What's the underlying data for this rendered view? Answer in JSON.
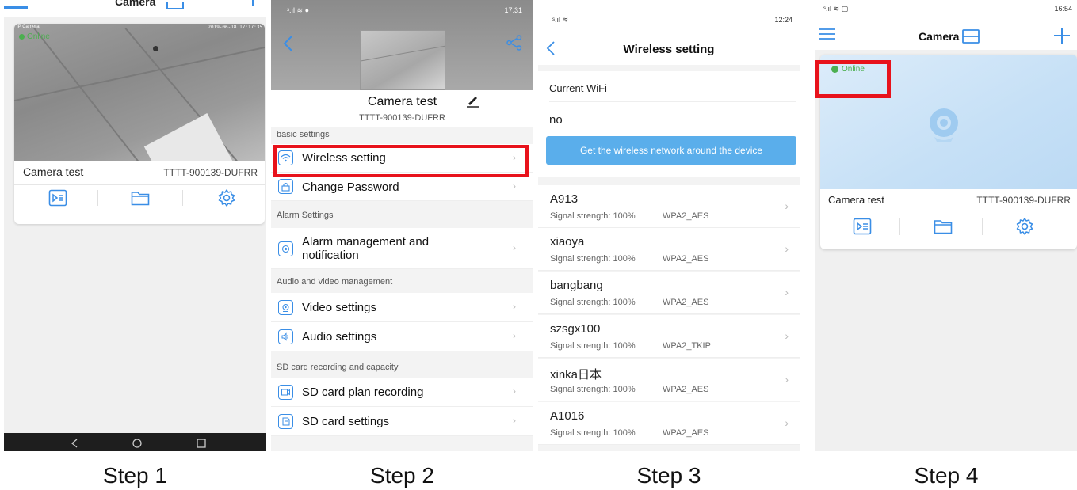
{
  "colors": {
    "accent": "#3a8ee6",
    "highlight": "#e8121b",
    "online": "#4caf50",
    "button": "#5aaeeb"
  },
  "step1": {
    "label": "Step 1",
    "header_title": "Camera",
    "osd_left": "IP Camera",
    "osd_right": "2019-06-18 17:17:35",
    "online": "Online",
    "camera_name": "Camera test",
    "camera_uid": "TTTT-900139-DUFRR",
    "actions": [
      "playback-icon",
      "folder-icon",
      "gear-icon"
    ]
  },
  "step2": {
    "label": "Step 2",
    "status_time": "17:31",
    "camera_name": "Camera test",
    "camera_uid": "TTTT-900139-DUFRR",
    "sections": {
      "basic": "basic settings",
      "alarm": "Alarm Settings",
      "av": "Audio and video management",
      "sd": "SD card recording and capacity"
    },
    "items": {
      "wireless": "Wireless setting",
      "password": "Change Password",
      "alarm": "Alarm management and notification",
      "video": "Video settings",
      "audio": "Audio settings",
      "sd_plan": "SD card plan recording",
      "sd_settings": "SD card settings"
    }
  },
  "step3": {
    "label": "Step 3",
    "status_time": "12:24",
    "title": "Wireless setting",
    "current_wifi_label": "Current WiFi",
    "current_wifi_value": "no",
    "scan_button": "Get the wireless network around the device",
    "networks": [
      {
        "ssid": "A913",
        "signal": "Signal strength: 100%",
        "enc": "WPA2_AES"
      },
      {
        "ssid": "xiaoya",
        "signal": "Signal strength: 100%",
        "enc": "WPA2_AES"
      },
      {
        "ssid": "bangbang",
        "signal": "Signal strength: 100%",
        "enc": "WPA2_AES"
      },
      {
        "ssid": "szsgx100",
        "signal": "Signal strength: 100%",
        "enc": "WPA2_TKIP"
      },
      {
        "ssid": "xinka日本",
        "signal": "Signal strength: 100%",
        "enc": "WPA2_AES"
      },
      {
        "ssid": "A1016",
        "signal": "Signal strength: 100%",
        "enc": "WPA2_AES"
      }
    ]
  },
  "step4": {
    "label": "Step 4",
    "status_time": "16:54",
    "header_title": "Camera",
    "online": "Online",
    "camera_name": "Camera test",
    "camera_uid": "TTTT-900139-DUFRR"
  }
}
